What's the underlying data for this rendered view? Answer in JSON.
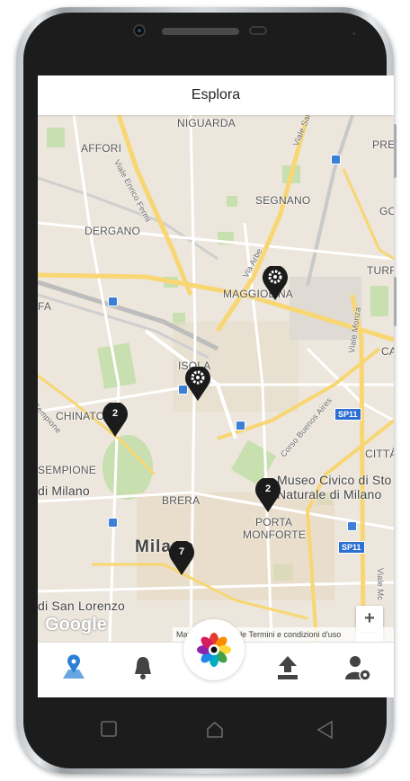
{
  "header": {
    "title": "Esplora"
  },
  "map": {
    "labels": {
      "niguarda": "NIGUARDA",
      "affori": "AFFORI",
      "viale_enrico_fermi": "Viale Enrico Fermi",
      "viale_sarca": "Viale Sarca",
      "pre": "PRE",
      "segnano": "SEGNANO",
      "go": "GO",
      "dergano": "DERGANO",
      "via_arbe": "Via Arbe",
      "turr": "TURR",
      "maggiolina": "MAGGIOLINA",
      "fa": "FA",
      "viale_monza": "Viale Monza",
      "ca": "CA",
      "isola": "ISOLA",
      "sempione_road": "Sempione",
      "chinatown": "CHINATOWN",
      "corso_buenos_aires": "Corso Buenos Aires",
      "citta": "CITTÀ",
      "sempione": "SEMPIONE",
      "di_milano": "di Milano",
      "museo_civico": "Museo Civico di Sto",
      "naturale": "Naturale di Milano",
      "brera": "BRERA",
      "porta": "PORTA",
      "monforte": "MONFORTE",
      "milano": "Milano",
      "di_san_lorenzo": "di San Lorenzo",
      "viale_mc": "Viale Mc"
    },
    "shields": {
      "sp11_a": "SP11",
      "sp11_b": "SP11"
    },
    "markers": [
      {
        "count": "2",
        "kind": "cluster"
      },
      {
        "count": "2",
        "kind": "cluster"
      },
      {
        "count": "7",
        "kind": "cluster"
      },
      {
        "count": "",
        "kind": "gear"
      },
      {
        "count": "",
        "kind": "gear"
      }
    ],
    "zoom_in": "+",
    "zoom_out": "−",
    "google_logo": "Google",
    "attribution": "Map  ©2017 Google   Termini e condizioni d'uso"
  },
  "nav": {
    "items": [
      {
        "icon": "map-pin-icon",
        "active": true
      },
      {
        "icon": "bell-icon",
        "active": false
      },
      {
        "icon": "flower-logo-icon",
        "active": false
      },
      {
        "icon": "upload-icon",
        "active": false
      },
      {
        "icon": "user-settings-icon",
        "active": false
      }
    ]
  },
  "colors": {
    "accent": "#2a7fd6",
    "marker": "#1b1b1b",
    "map_bg": "#ece6dc",
    "road_major": "#f8d672"
  }
}
